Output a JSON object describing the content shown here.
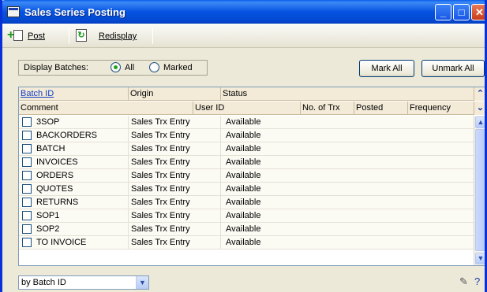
{
  "window": {
    "title": "Sales Series Posting"
  },
  "toolbar": {
    "post_label": "Post",
    "redisplay_label": "Redisplay"
  },
  "filter": {
    "label": "Display Batches:",
    "options": [
      "All",
      "Marked"
    ],
    "selected": "All"
  },
  "buttons": {
    "mark_all": "Mark All",
    "unmark_all": "Unmark All"
  },
  "grid": {
    "header_row1": [
      "Batch ID",
      "Origin",
      "Status"
    ],
    "header_row2": [
      "Comment",
      "User ID",
      "No. of Trx",
      "Posted",
      "Frequency"
    ],
    "rows": [
      {
        "batch_id": "3SOP",
        "origin": "Sales Trx Entry",
        "status": "Available"
      },
      {
        "batch_id": "BACKORDERS",
        "origin": "Sales Trx Entry",
        "status": "Available"
      },
      {
        "batch_id": "BATCH",
        "origin": "Sales Trx Entry",
        "status": "Available"
      },
      {
        "batch_id": "INVOICES",
        "origin": "Sales Trx Entry",
        "status": "Available"
      },
      {
        "batch_id": "ORDERS",
        "origin": "Sales Trx Entry",
        "status": "Available"
      },
      {
        "batch_id": "QUOTES",
        "origin": "Sales Trx Entry",
        "status": "Available"
      },
      {
        "batch_id": "RETURNS",
        "origin": "Sales Trx Entry",
        "status": "Available"
      },
      {
        "batch_id": "SOP1",
        "origin": "Sales Trx Entry",
        "status": "Available"
      },
      {
        "batch_id": "SOP2",
        "origin": "Sales Trx Entry",
        "status": "Available"
      },
      {
        "batch_id": "TO INVOICE",
        "origin": "Sales Trx Entry",
        "status": "Available"
      }
    ]
  },
  "footer": {
    "sort_by": "by Batch ID"
  },
  "icons": [
    "window-icon",
    "post-icon",
    "redisplay-icon",
    "expand-icon",
    "collapse-icon",
    "note-icon",
    "help-icon"
  ]
}
